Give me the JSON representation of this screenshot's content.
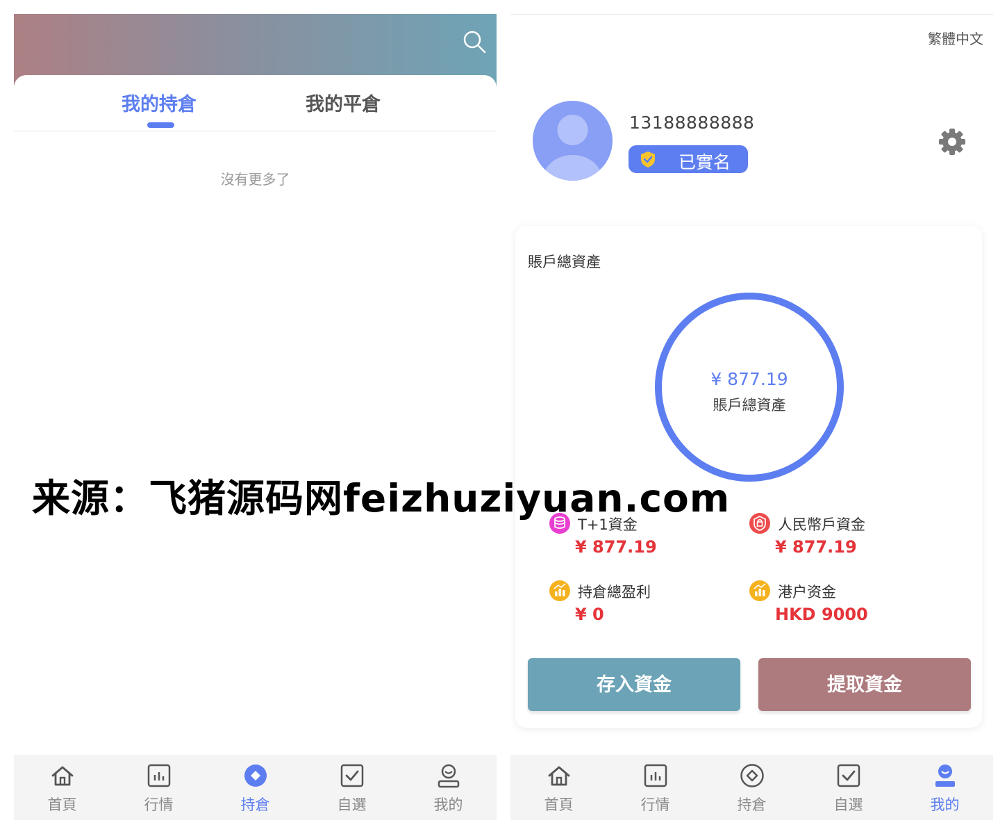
{
  "left": {
    "tabs": [
      {
        "label": "我的持倉",
        "active": true
      },
      {
        "label": "我的平倉",
        "active": false
      }
    ],
    "empty_message": "沒有更多了",
    "icons": {
      "search": "search-icon"
    }
  },
  "right": {
    "language": "繁體中文",
    "user": {
      "phone": "13188888888",
      "verified_label": "已實名"
    },
    "asset_card": {
      "title": "賬戶總資產",
      "ring_amount": "¥  877.19",
      "ring_label": "賬戶總資產",
      "funds": [
        {
          "label": "T+1資金",
          "value": "¥ 877.19",
          "icon": "database-icon",
          "color": "#e93fd0"
        },
        {
          "label": "人民幣戶資金",
          "value": "¥ 877.19",
          "icon": "lock-badge-icon",
          "color": "#ee4b4b"
        },
        {
          "label": "持倉總盈利",
          "value": "¥ 0",
          "icon": "chart-coin-icon",
          "color": "#f5b21d"
        },
        {
          "label": "港户资金",
          "value": "HKD 9000",
          "icon": "chart-coin-icon",
          "color": "#f5b21d"
        }
      ],
      "deposit_label": "存入資金",
      "withdraw_label": "提取資金"
    }
  },
  "nav": {
    "items": [
      {
        "label": "首頁",
        "icon": "home-icon"
      },
      {
        "label": "行情",
        "icon": "market-chart-icon"
      },
      {
        "label": "持倉",
        "icon": "position-icon"
      },
      {
        "label": "自選",
        "icon": "checkbox-icon"
      },
      {
        "label": "我的",
        "icon": "user-icon"
      }
    ],
    "left_active": "持倉",
    "right_active": "我的"
  },
  "colors": {
    "accent": "#5d7ef0",
    "deposit": "#6ca3b6",
    "withdraw": "#ad7b7e",
    "value_red": "#e5343a"
  },
  "watermark": "来源：飞猪源码网feizhuziyuan.com"
}
